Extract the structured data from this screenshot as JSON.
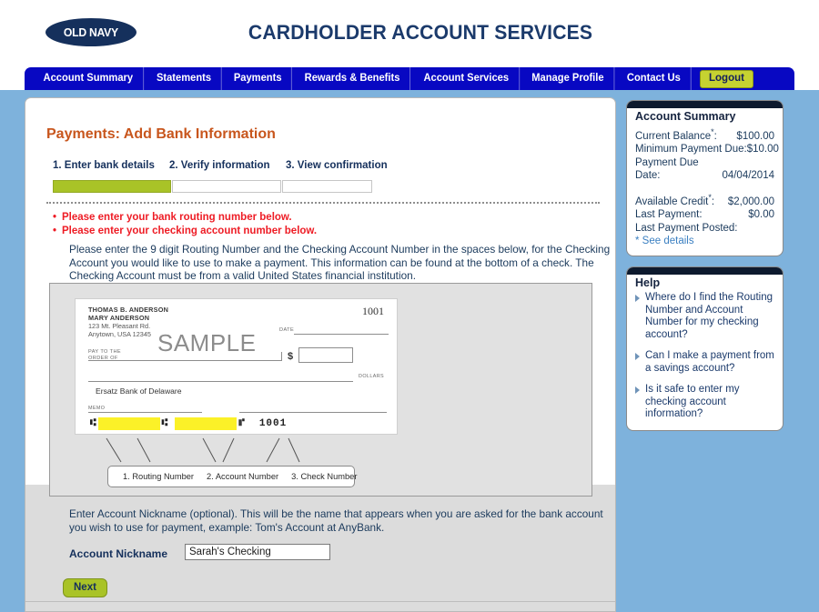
{
  "header": {
    "logo_text": "OLD NAVY",
    "site_title": "CARDHOLDER ACCOUNT SERVICES"
  },
  "nav": {
    "items": [
      {
        "label": "Account Summary"
      },
      {
        "label": "Statements"
      },
      {
        "label": "Payments"
      },
      {
        "label": "Rewards & Benefits"
      },
      {
        "label": "Account Services"
      },
      {
        "label": "Manage Profile"
      },
      {
        "label": "Contact Us"
      }
    ],
    "logout_label": "Logout"
  },
  "main": {
    "page_title": "Payments: Add Bank Information",
    "steps": [
      {
        "label": "1. Enter bank details"
      },
      {
        "label": "2. Verify information"
      },
      {
        "label": "3. View confirmation"
      }
    ],
    "errors": [
      "Please enter your bank routing number below.",
      "Please enter your checking account number below."
    ],
    "intro": "Please enter the 9 digit Routing Number and the Checking Account Number in the spaces below, for the Checking Account you would like to use to make a payment. This information can be found at the bottom of a check. The Checking Account must be from a valid United States financial institution.",
    "nickname_help": "Enter Account Nickname (optional). This will be the name that appears when you are asked for the bank account you wish to use for payment, example: Tom's Account at AnyBank.",
    "nickname_label": "Account Nickname",
    "nickname_value": "Sarah's Checking",
    "nickname_placeholder": "",
    "next_label": "Next"
  },
  "check": {
    "name_line1": "THOMAS B. ANDERSON",
    "name_line2": "MARY ANDERSON",
    "address_line1": "123 Mt. Pleasant Rd.",
    "address_line2": "Anytown, USA  12345",
    "check_number": "1001",
    "watermark": "SAMPLE",
    "date_label": "DATE",
    "pay_to_label": "PAY TO THE",
    "order_of_label": "ORDER OF",
    "dollar_sign": "$",
    "dollars_label": "DOLLARS",
    "bank_name": "Ersatz Bank of Delaware",
    "memo_label": "MEMO",
    "micr_start": "⑆",
    "micr_mid": "⑆",
    "micr_end": "⑈",
    "micr_check_number": "⑈1001⑈",
    "callouts": [
      "1. Routing Number",
      "2. Account Number",
      "3. Check Number"
    ]
  },
  "sidebar": {
    "account_summary": {
      "title": "Account Summary",
      "rows": [
        {
          "label": "Current Balance",
          "asterisk": true,
          "value": "$100.00"
        },
        {
          "label": "Minimum Payment Due:",
          "asterisk": false,
          "value": "$10.00"
        }
      ],
      "payment_due_label": "Payment Due",
      "payment_due_date_label": "Date:",
      "payment_due_date": "04/04/2014",
      "rows2": [
        {
          "label": "Available Credit",
          "asterisk": true,
          "value": "$2,000.00"
        },
        {
          "label": "Last Payment:",
          "asterisk": false,
          "value": "$0.00"
        }
      ],
      "last_posted_label": "Last Payment Posted:",
      "last_posted_value": "",
      "see_details": "* See details"
    },
    "help": {
      "title": "Help",
      "links": [
        "Where do I find the Routing Number and Account Number for my checking account?",
        "Can I make a payment from a savings account?",
        "Is it safe to enter my checking account information?"
      ]
    }
  },
  "colors": {
    "nav_blue": "#0808c2",
    "page_blue": "#7eb2dc",
    "accent_green": "#a9c327",
    "logout_green": "#c6d231",
    "title_orange": "#c8561d",
    "error_red": "#ee1c25",
    "link_blue": "#3a7fc1",
    "highlight_yellow": "#fbf128",
    "panel_gray": "#dcdcdc"
  }
}
